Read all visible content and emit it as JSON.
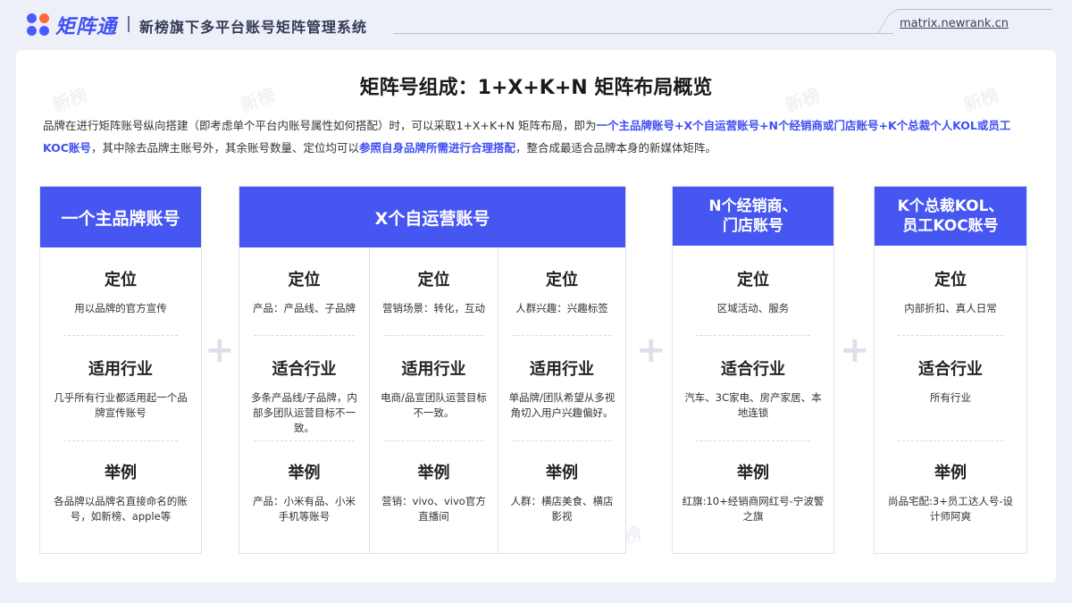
{
  "header": {
    "logo_text": "矩阵通",
    "subtitle": "新榜旗下多平台账号矩阵管理系统",
    "url": "matrix.newrank.cn"
  },
  "main": {
    "title": "矩阵号组成：1+X+K+N 矩阵布局概览",
    "description": {
      "p1": "品牌在进行矩阵账号纵向搭建（即考虑单个平台内账号属性如何搭配）时，可以采取1+X+K+N 矩阵布局，即为",
      "h1": "一个主品牌账号+X个自运营账号+N个经销商或门店账号+K个总裁个人KOL或员工KOC账号",
      "p2": "，其中除去品牌主账号外，其余账号数量、定位均可以",
      "h2": "参照自身品牌所需进行合理搭配",
      "p3": "，整合成最适合品牌本身的新媒体矩阵。"
    },
    "plus_sign": "+",
    "watermark": "新榜",
    "columns": [
      {
        "head_lines": [
          "一个主品牌账号"
        ],
        "subs": [
          {
            "positioning_title": "定位",
            "positioning": "用以品牌的官方宣传",
            "industry_title": "适用行业",
            "industry": "几乎所有行业都适用起一个品牌宣传账号",
            "example_title": "举例",
            "example": "各品牌以品牌名直接命名的账号，如新榜、apple等"
          }
        ]
      },
      {
        "head_lines": [
          "X个自运营账号"
        ],
        "subs": [
          {
            "positioning_title": "定位",
            "positioning": "产品：产品线、子品牌",
            "industry_title": "适合行业",
            "industry": "多条产品线/子品牌，内部多团队运营目标不一致。",
            "example_title": "举例",
            "example": "产品：小米有品、小米手机等账号"
          },
          {
            "positioning_title": "定位",
            "positioning": "营销场景：转化，互动",
            "industry_title": "适用行业",
            "industry": "电商/品宣团队运营目标不一致。",
            "example_title": "举例",
            "example": "营销：vivo、vivo官方直播间"
          },
          {
            "positioning_title": "定位",
            "positioning": "人群兴趣：兴趣标签",
            "industry_title": "适用行业",
            "industry": "单品牌/团队希望从多视角切入用户兴趣偏好。",
            "example_title": "举例",
            "example": "人群：横店美食、横店影视"
          }
        ]
      },
      {
        "head_lines": [
          "N个经销商、",
          "门店账号"
        ],
        "subs": [
          {
            "positioning_title": "定位",
            "positioning": "区域活动、服务",
            "industry_title": "适合行业",
            "industry": "汽车、3C家电、房产家居、本地连锁",
            "example_title": "举例",
            "example": "红旗:10+经销商网红号-宁波警之旗"
          }
        ]
      },
      {
        "head_lines": [
          "K个总裁KOL、",
          "员工KOC账号"
        ],
        "subs": [
          {
            "positioning_title": "定位",
            "positioning": "内部折扣、真人日常",
            "industry_title": "适合行业",
            "industry": "所有行业",
            "example_title": "举例",
            "example": "尚品宅配:3+员工达人号-设计师阿爽"
          }
        ]
      }
    ]
  }
}
